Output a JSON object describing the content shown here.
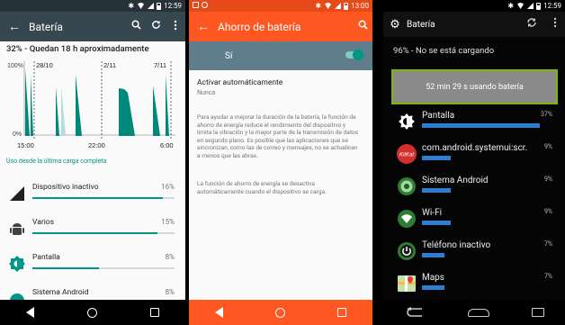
{
  "screen1": {
    "status_time": "12:59",
    "title": "Batería",
    "remaining": "32% - Quedan 18 h aproximadamente",
    "y_top": "100%",
    "y_bottom": "0%",
    "date_labels": [
      "28/10",
      "2/11",
      "7/11"
    ],
    "time_labels": [
      "15:00",
      "22:00",
      "6:00"
    ],
    "usage_link": "Uso desde la última carga completa",
    "items": [
      {
        "label": "Dispositivo inactivo",
        "pct": "16%",
        "fill": 0.92
      },
      {
        "label": "Varios",
        "pct": "15%",
        "fill": 0.88
      },
      {
        "label": "Pantalla",
        "pct": "8%",
        "fill": 0.47
      },
      {
        "label": "Sistema Android",
        "pct": "8%",
        "fill": 0.45
      }
    ]
  },
  "screen2": {
    "status_time": "13:00",
    "title": "Ahorro de batería",
    "switch_label": "Sí",
    "switch_on": true,
    "auto_title": "Activar automáticamente",
    "auto_value": "Nunca",
    "paragraph1": "Para ayudar a mejorar la duración de la batería, la función de ahorro de energía reduce el rendimiento del dispositivo y limita la vibración y la mayor parte de la transmisión de datos en segundo plano. Es posible que las aplicaciones que se sincronizan, como las de correo y mensajes, no se actualicen a menos que las abras.",
    "paragraph2": "La función de ahorro de energía se desactiva automáticamente cuando el dispositivo se carga."
  },
  "screen3": {
    "status_time": "12:59",
    "title": "Batería",
    "status": "96% - No se está cargando",
    "graph_text": "52 min 29 s usando batería",
    "items": [
      {
        "label": "Pantalla",
        "pct": "37%",
        "value": 37
      },
      {
        "label": "com.android.systemui:scr.",
        "pct": "9%",
        "value": 9
      },
      {
        "label": "Sistema Android",
        "pct": "9%",
        "value": 9
      },
      {
        "label": "Wi-Fi",
        "pct": "9%",
        "value": 9
      },
      {
        "label": "Teléfono inactivo",
        "pct": "7%",
        "value": 7
      },
      {
        "label": "Maps",
        "pct": "7%",
        "value": 7
      }
    ]
  },
  "colors": {
    "teal": "#009688",
    "orange": "#ff5722",
    "blue_grey": "#37474f",
    "holo_blue": "#2c7fd0"
  }
}
